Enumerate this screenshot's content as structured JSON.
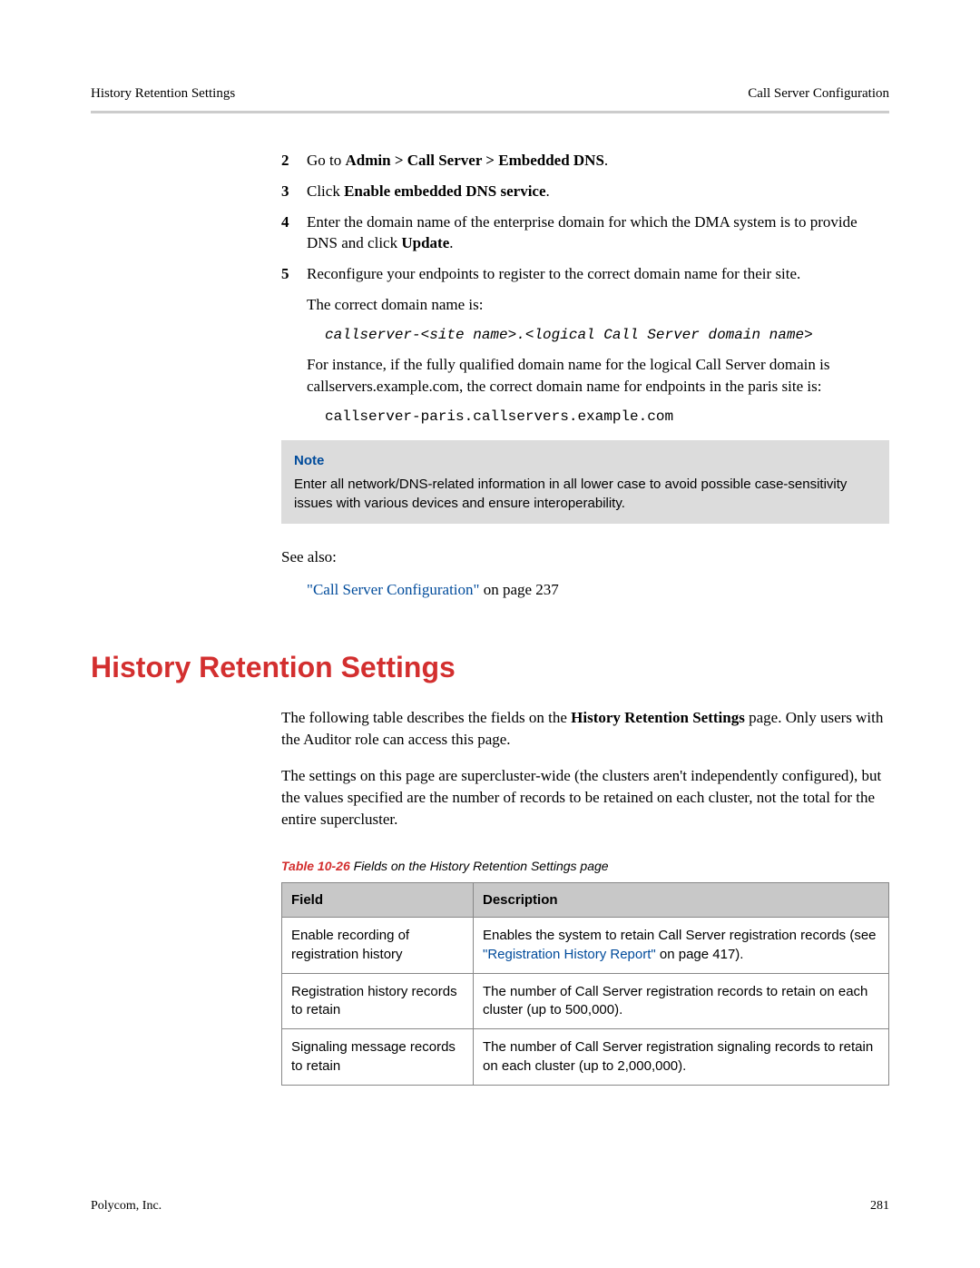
{
  "header": {
    "left": "History Retention Settings",
    "right": "Call Server Configuration"
  },
  "steps": {
    "s2": {
      "num": "2",
      "prefix": "Go to ",
      "bold": "Admin > Call Server > Embedded DNS",
      "suffix": "."
    },
    "s3": {
      "num": "3",
      "prefix": "Click ",
      "bold": "Enable embedded DNS service",
      "suffix": "."
    },
    "s4": {
      "num": "4",
      "prefix": "Enter the domain name of the enterprise domain for which the DMA system is to provide DNS and click ",
      "bold": "Update",
      "suffix": "."
    },
    "s5": {
      "num": "5",
      "text": "Reconfigure your endpoints to register to the correct domain name for their site."
    }
  },
  "para": {
    "correct_domain": "The correct domain name is:",
    "domain_pattern": "callserver-<site name>.<logical Call Server domain name>",
    "for_instance": "For instance, if the fully qualified domain name for the logical Call Server domain is callservers.example.com, the correct domain name for endpoints in the paris site is:",
    "example_domain": "callserver-paris.callservers.example.com",
    "see_also": "See also:",
    "link_text": "\"Call Server Configuration\"",
    "link_suffix": " on page 237"
  },
  "note": {
    "title": "Note",
    "body": "Enter all network/DNS-related information in all lower case to avoid possible case-sensitivity issues with various devices and ensure interoperability."
  },
  "section": {
    "heading": "History Retention Settings",
    "intro1_a": "The following table describes the fields on the ",
    "intro1_b": "History Retention Settings",
    "intro1_c": " page. Only users with the Auditor role can access this page.",
    "intro2": "The settings on this page are supercluster-wide (the clusters aren't independently configured), but the values specified are the number of records to be retained on each cluster, not the total for the entire supercluster."
  },
  "table": {
    "caption_label": "Table 10-26",
    "caption_text": "  Fields on the History Retention Settings page",
    "headers": {
      "field": "Field",
      "description": "Description"
    },
    "rows": [
      {
        "field": "Enable recording of registration history",
        "desc_a": "Enables the system to retain Call Server registration records (see ",
        "desc_link": "\"Registration History Report\"",
        "desc_b": " on page 417)."
      },
      {
        "field": "Registration history records to retain",
        "desc": "The number of Call Server registration records to retain on each cluster (up to 500,000)."
      },
      {
        "field": "Signaling message records to retain",
        "desc": "The number of Call Server registration signaling records to retain on each cluster (up to 2,000,000)."
      }
    ]
  },
  "footer": {
    "left": "Polycom, Inc.",
    "right": "281"
  }
}
